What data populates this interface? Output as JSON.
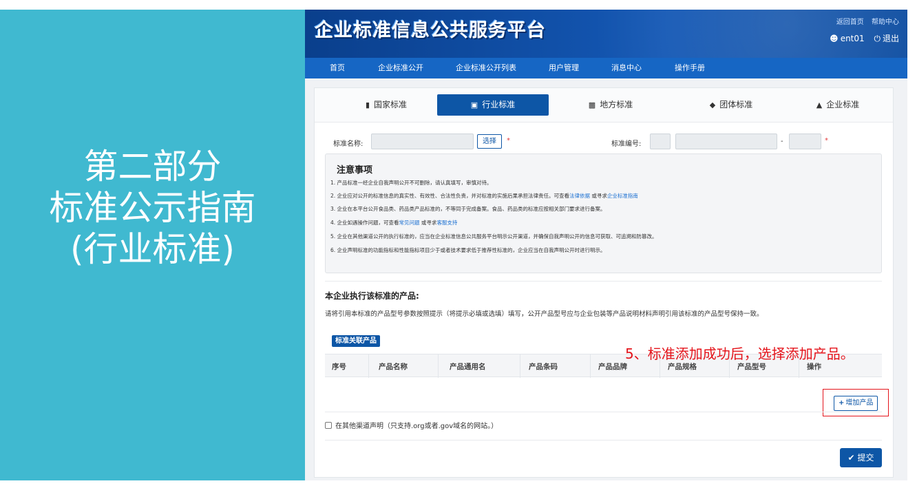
{
  "slide": {
    "title_lines": [
      "第二部分",
      "标准公示指南",
      "(行业标准)"
    ],
    "callout": "5、标准添加成功后，选择添加产品。"
  },
  "header": {
    "logo": "企业标准信息公共服务平台",
    "links": [
      "返回首页",
      "帮助中心"
    ],
    "user": "ent01",
    "logout": "退出"
  },
  "nav": {
    "items": [
      "首页",
      "企业标准公开",
      "企业标准公开列表",
      "用户管理",
      "消息中心",
      "操作手册"
    ]
  },
  "tabs": [
    {
      "label": "国家标准",
      "icon": "book-icon"
    },
    {
      "label": "行业标准",
      "icon": "briefcase-icon",
      "active": true
    },
    {
      "label": "地方标准",
      "icon": "file-icon"
    },
    {
      "label": "团体标准",
      "icon": "shield-icon"
    },
    {
      "label": "企业标准",
      "icon": "institution-icon"
    }
  ],
  "form": {
    "std_name_label": "标准名称:",
    "choose_button": "选择",
    "required_mark": "*",
    "std_no_label": "标准编号:",
    "dash": "-"
  },
  "notice": {
    "title": "注意事项",
    "lines": [
      {
        "text": "1. 产品标准一经企业自我声明公开不可删除，请认真填写，审慎对待。"
      },
      {
        "before": "2. 企业应对公开的标准信息的真实性、有效性、合法性负责，并对标准的实施后果承担法律责任。可查看",
        "link1": "法律依据",
        "middle": " 或寻求",
        "link2": "企业标准指南",
        "after": ""
      },
      {
        "text": "3. 企业在本平台公开食品类、药品类产品标准的，不等同于完成备案。食品、药品类的标准应按相关部门要求进行备案。"
      },
      {
        "before": "4. 企业如遇操作问题，可查看",
        "link1": "常见问题",
        "middle": " 或寻求",
        "link2": "客服支持",
        "after": ""
      },
      {
        "text": "5. 企业在其他渠道公开的执行标准的，应当在企业标准信息公共服务平台明示公开渠道，并确保自我声明公开的信息可获取、可追溯和防篡改。"
      },
      {
        "text": "6. 企业声明标准的功能指标和性能指标项目少于或者技术要求低于推荐性标准的，企业应当在自我声明公开时进行明示。"
      }
    ]
  },
  "products": {
    "heading": "本企业执行该标准的产品:",
    "description": "请将引用本标准的产品型号参数按照提示（将提示必填或选填）填写，公开产品型号应与企业包装等产品说明材料声明引用该标准的产品型号保持一致。",
    "table_tag": "标准关联产品",
    "columns": [
      "序号",
      "产品名称",
      "产品通用名",
      "产品条码",
      "产品品牌",
      "产品规格",
      "产品型号",
      "操作"
    ],
    "add_button": "增加产品"
  },
  "other_channel": "在其他渠道声明（只支持.org或者.gov域名的网站。）",
  "submit": "提交"
}
